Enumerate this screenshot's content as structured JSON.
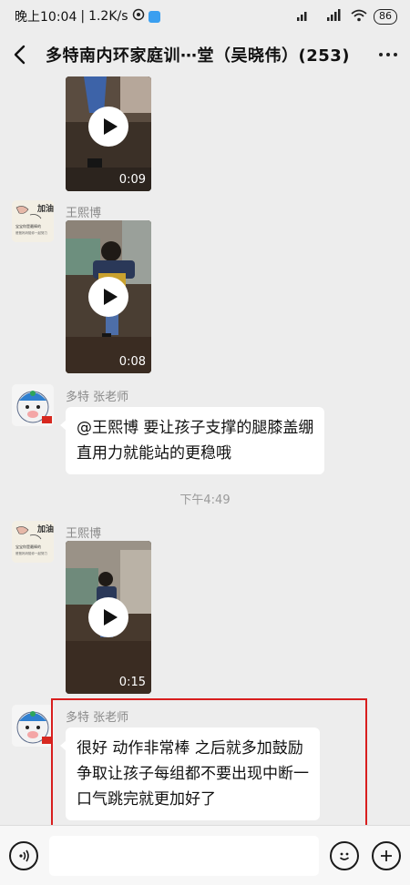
{
  "status_bar": {
    "time": "晚上10:04",
    "speed": "1.2K/s",
    "signal1": "HD",
    "signal2": "HD",
    "battery": "86"
  },
  "header": {
    "title": "多特南内环家庭训⋯堂（吴晓伟）(253)"
  },
  "messages": [
    {
      "sender": "",
      "duration": "0:09"
    },
    {
      "sender": "王熙博",
      "duration": "0:08"
    },
    {
      "sender": "多特 张老师",
      "lines": [
        "@王熙博  要让孩子支撑的腿膝盖绷",
        "直用力就能站的更稳哦"
      ]
    },
    {
      "timestamp": "下午4:49"
    },
    {
      "sender": "王熙博",
      "duration": "0:15"
    },
    {
      "sender": "多特 张老师",
      "lines": [
        "很好  动作非常棒 之后就多加鼓励",
        "争取让孩子每组都不要出现中断一",
        "口气跳完就更加好了"
      ]
    }
  ],
  "avatar_caption": {
    "lines": [
      "加油!",
      "宝宝你是最棒的",
      "爸爸妈妈陪你一起努力"
    ]
  },
  "input": {
    "value": "",
    "placeholder": ""
  },
  "icons": {
    "back": "chevron-left-icon",
    "more": "more-dots-icon",
    "voice": "voice-icon",
    "emoji": "emoji-icon",
    "plus": "plus-icon",
    "play": "play-icon"
  },
  "colors": {
    "highlight": "#d81e1e",
    "background": "#ededed",
    "bubble": "#ffffff"
  }
}
